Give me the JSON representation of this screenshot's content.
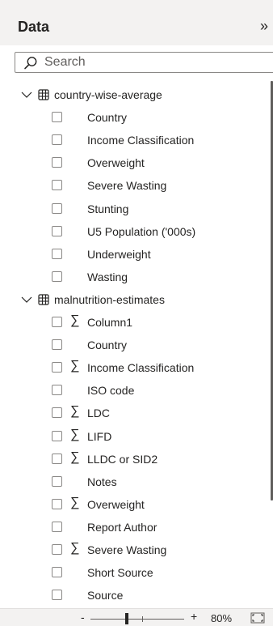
{
  "pane": {
    "title": "Data",
    "collapse_glyph": "»",
    "collapse_icon": "double-chevron-right-icon"
  },
  "search": {
    "placeholder": "Search",
    "value": ""
  },
  "tables": [
    {
      "name": "country-wise-average",
      "expanded": true,
      "fields": [
        {
          "label": "Country",
          "aggregate": false
        },
        {
          "label": "Income Classification",
          "aggregate": false
        },
        {
          "label": "Overweight",
          "aggregate": false
        },
        {
          "label": "Severe Wasting",
          "aggregate": false
        },
        {
          "label": "Stunting",
          "aggregate": false
        },
        {
          "label": "U5 Population ('000s)",
          "aggregate": false
        },
        {
          "label": "Underweight",
          "aggregate": false
        },
        {
          "label": "Wasting",
          "aggregate": false
        }
      ]
    },
    {
      "name": "malnutrition-estimates",
      "expanded": true,
      "fields": [
        {
          "label": "Column1",
          "aggregate": true
        },
        {
          "label": "Country",
          "aggregate": false
        },
        {
          "label": "Income Classification",
          "aggregate": true
        },
        {
          "label": "ISO code",
          "aggregate": false
        },
        {
          "label": "LDC",
          "aggregate": true
        },
        {
          "label": "LIFD",
          "aggregate": true
        },
        {
          "label": "LLDC or SID2",
          "aggregate": true
        },
        {
          "label": "Notes",
          "aggregate": false
        },
        {
          "label": "Overweight",
          "aggregate": true
        },
        {
          "label": "Report Author",
          "aggregate": false
        },
        {
          "label": "Severe Wasting",
          "aggregate": true
        },
        {
          "label": "Short Source",
          "aggregate": false
        },
        {
          "label": "Source",
          "aggregate": false
        }
      ]
    }
  ],
  "footer": {
    "zoom_minus": "-",
    "zoom_plus": "+",
    "zoom_value": "80%",
    "zoom_level": 0.8,
    "fit_icon": "fit-to-page-icon"
  },
  "colors": {
    "header_bg": "#f3f2f1",
    "text": "#252423",
    "border": "#8a8886"
  }
}
